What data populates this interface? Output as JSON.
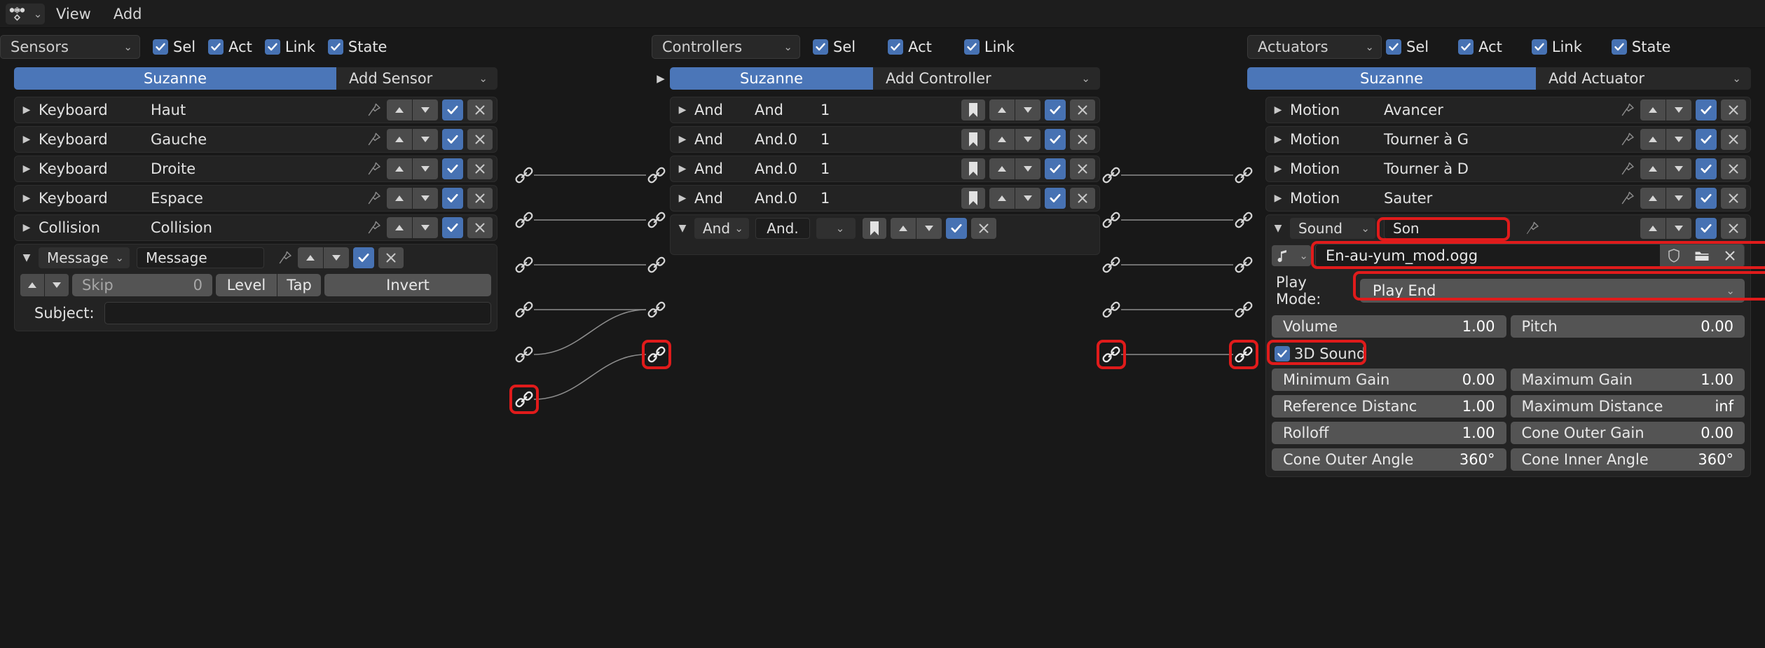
{
  "menubar": {
    "editor_icon": "logic-editor-icon",
    "items": [
      "View",
      "Add"
    ]
  },
  "columns": {
    "sensors": {
      "type_label": "Sensors",
      "filters": [
        {
          "label": "Sel",
          "checked": true
        },
        {
          "label": "Act",
          "checked": true
        },
        {
          "label": "Link",
          "checked": true
        },
        {
          "label": "State",
          "checked": true
        }
      ],
      "object_name": "Suzanne",
      "add_label": "Add Sensor",
      "rows": [
        {
          "type": "Keyboard",
          "name": "Haut",
          "expanded": false,
          "enabled": true
        },
        {
          "type": "Keyboard",
          "name": "Gauche",
          "expanded": false,
          "enabled": true
        },
        {
          "type": "Keyboard",
          "name": "Droite",
          "expanded": false,
          "enabled": true
        },
        {
          "type": "Keyboard",
          "name": "Espace",
          "expanded": false,
          "enabled": true
        },
        {
          "type": "Collision",
          "name": "Collision",
          "expanded": false,
          "enabled": true
        },
        {
          "type": "Message",
          "name": "Message",
          "expanded": true,
          "enabled": true
        }
      ],
      "message_panel": {
        "skip_label": "Skip",
        "skip_value": "0",
        "level_label": "Level",
        "tap_label": "Tap",
        "invert_label": "Invert",
        "subject_label": "Subject:",
        "subject_value": ""
      }
    },
    "controllers": {
      "type_label": "Controllers",
      "filters": [
        {
          "label": "Sel",
          "checked": true
        },
        {
          "label": "Act",
          "checked": true
        },
        {
          "label": "Link",
          "checked": true
        }
      ],
      "object_name": "Suzanne",
      "add_label": "Add Controller",
      "rows": [
        {
          "type": "And",
          "name": "And",
          "state": "1",
          "expanded": false,
          "enabled": true
        },
        {
          "type": "And",
          "name": "And.0",
          "state": "1",
          "expanded": false,
          "enabled": true
        },
        {
          "type": "And",
          "name": "And.0",
          "state": "1",
          "expanded": false,
          "enabled": true
        },
        {
          "type": "And",
          "name": "And.0",
          "state": "1",
          "expanded": false,
          "enabled": true
        },
        {
          "type": "And",
          "name": "And.",
          "state": "",
          "expanded": true,
          "enabled": true
        }
      ]
    },
    "actuators": {
      "type_label": "Actuators",
      "filters": [
        {
          "label": "Sel",
          "checked": true
        },
        {
          "label": "Act",
          "checked": true
        },
        {
          "label": "Link",
          "checked": true
        },
        {
          "label": "State",
          "checked": true
        }
      ],
      "object_name": "Suzanne",
      "add_label": "Add Actuator",
      "rows": [
        {
          "type": "Motion",
          "name": "Avancer",
          "expanded": false,
          "enabled": true
        },
        {
          "type": "Motion",
          "name": "Tourner à G",
          "expanded": false,
          "enabled": true
        },
        {
          "type": "Motion",
          "name": "Tourner à D",
          "expanded": false,
          "enabled": true
        },
        {
          "type": "Motion",
          "name": "Sauter",
          "expanded": false,
          "enabled": true
        },
        {
          "type": "Sound",
          "name": "Son",
          "expanded": true,
          "enabled": true
        }
      ],
      "sound_panel": {
        "file_name": "En-au-yum_mod.ogg",
        "play_mode_label": "Play Mode:",
        "play_mode_value": "Play End",
        "sound_icon": "music-note-icon",
        "fields": [
          {
            "label": "Volume",
            "value": "1.00"
          },
          {
            "label": "Pitch",
            "value": "0.00"
          },
          {
            "label": "Minimum Gain",
            "value": "0.00"
          },
          {
            "label": "Maximum Gain",
            "value": "1.00"
          },
          {
            "label": "Reference Distanc",
            "value": "1.00"
          },
          {
            "label": "Maximum Distance",
            "value": "inf"
          },
          {
            "label": "Rolloff",
            "value": "1.00"
          },
          {
            "label": "Cone Outer Gain",
            "value": "0.00"
          },
          {
            "label": "Cone Outer Angle",
            "value": "360°"
          },
          {
            "label": "Cone Inner Angle",
            "value": "360°"
          }
        ],
        "three_d_sound": {
          "label": "3D Sound",
          "checked": true
        }
      }
    }
  },
  "colors": {
    "accent_blue": "#4772b3",
    "object_blue": "#4b76b8",
    "highlight_red": "#e01b1b",
    "background": "#181818",
    "brick_bg": "#232323"
  }
}
